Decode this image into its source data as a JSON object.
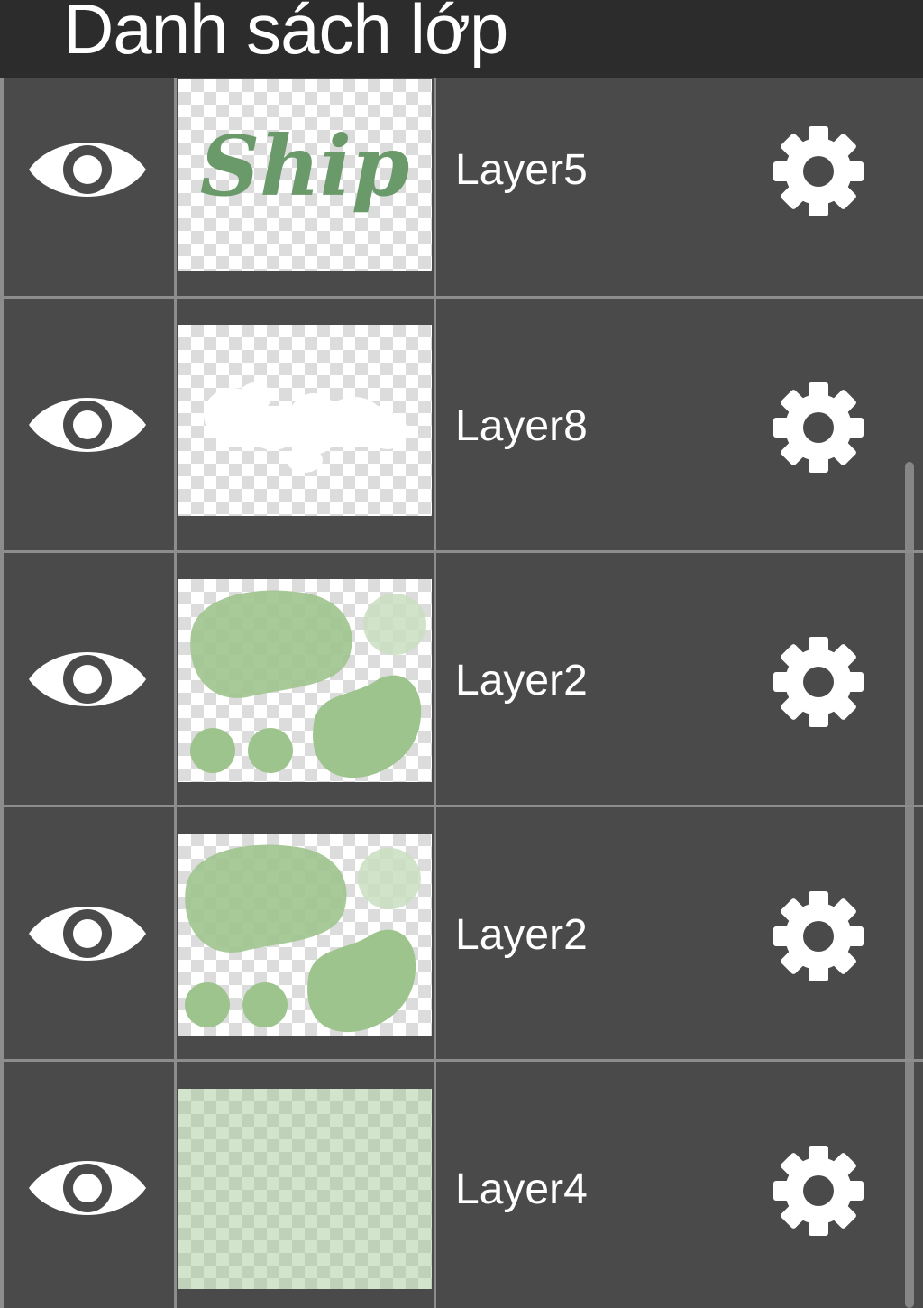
{
  "header": {
    "title": "Danh sách lớp"
  },
  "colors": {
    "background": "#4a4a4a",
    "header_background": "#2c2c2c",
    "divider": "#8d8d8d",
    "text": "#ffffff",
    "thumb_green": "#9ec48e",
    "thumb_text_green": "#6a9a6a"
  },
  "layers": [
    {
      "name": "Layer5",
      "visible": true,
      "thumbnail": "ship-lettering-green",
      "visibility_icon": "eye-icon",
      "settings_icon": "gear-icon",
      "thumb_text": "Ship"
    },
    {
      "name": "Layer8",
      "visible": true,
      "thumbnail": "ship-lettering-white",
      "visibility_icon": "eye-icon",
      "settings_icon": "gear-icon"
    },
    {
      "name": "Layer2",
      "visible": true,
      "thumbnail": "green-blobs",
      "visibility_icon": "eye-icon",
      "settings_icon": "gear-icon"
    },
    {
      "name": "Layer2",
      "visible": true,
      "thumbnail": "green-blobs",
      "visibility_icon": "eye-icon",
      "settings_icon": "gear-icon"
    },
    {
      "name": "Layer4",
      "visible": true,
      "thumbnail": "light-green-fill",
      "visibility_icon": "eye-icon",
      "settings_icon": "gear-icon"
    }
  ]
}
